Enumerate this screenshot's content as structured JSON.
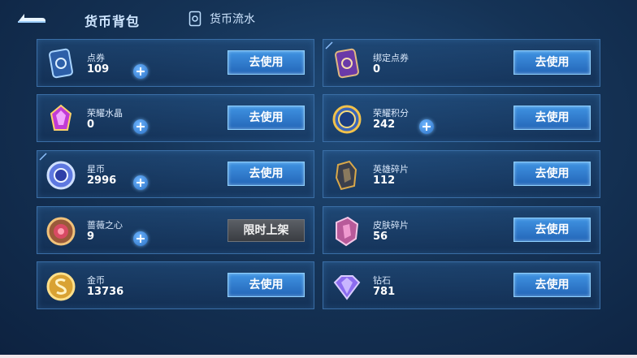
{
  "header": {
    "title": "货币背包",
    "flow_label": "货币流水"
  },
  "buttons": {
    "use_label": "去使用",
    "limited_label": "限时上架"
  },
  "currencies": [
    {
      "name": "点券",
      "amount": "109",
      "icon": "ticket-card-icon"
    },
    {
      "name": "绑定点券",
      "amount": "0",
      "icon": "bound-ticket-card-icon"
    },
    {
      "name": "荣耀水晶",
      "amount": "0",
      "icon": "glory-crystal-icon"
    },
    {
      "name": "荣耀积分",
      "amount": "242",
      "icon": "glory-points-icon"
    },
    {
      "name": "星币",
      "amount": "2996",
      "icon": "star-coin-icon"
    },
    {
      "name": "英雄碎片",
      "amount": "112",
      "icon": "hero-fragment-icon"
    },
    {
      "name": "蔷薇之心",
      "amount": "9",
      "icon": "rose-heart-icon"
    },
    {
      "name": "皮肤碎片",
      "amount": "56",
      "icon": "skin-fragment-icon"
    },
    {
      "name": "金币",
      "amount": "13736",
      "icon": "gold-coin-icon"
    },
    {
      "name": "钻石",
      "amount": "781",
      "icon": "diamond-icon"
    }
  ]
}
